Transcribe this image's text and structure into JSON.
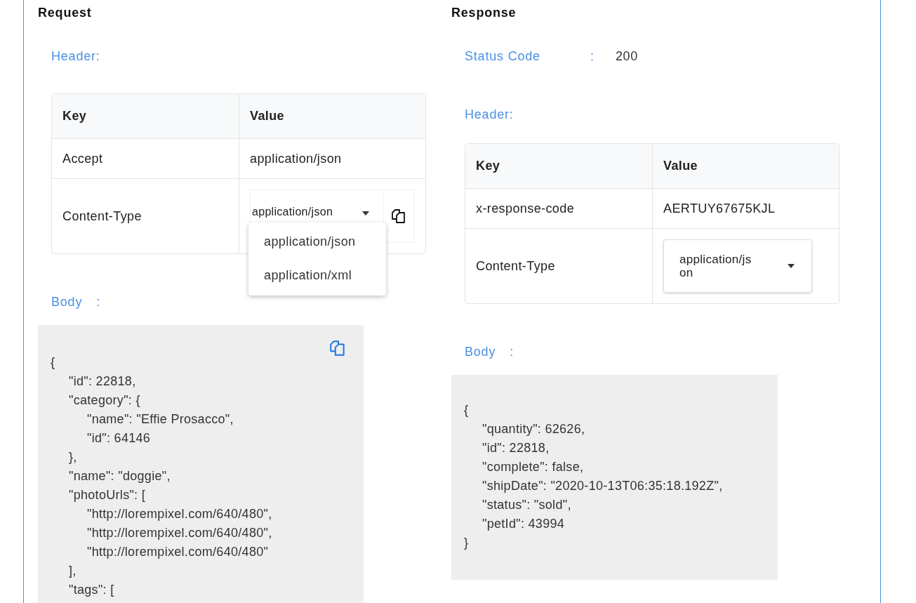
{
  "request": {
    "title": "Request",
    "header_label": "Header:",
    "table": {
      "columns": [
        "Key",
        "Value"
      ],
      "rows": [
        {
          "key": "Accept",
          "kind": "text",
          "value": "application/json"
        },
        {
          "key": "Content-Type",
          "kind": "select",
          "value": "application/json",
          "expanded": true,
          "options": [
            "application/json",
            "application/xml"
          ]
        }
      ]
    },
    "body_label": "Body",
    "body_colon": ":",
    "body": "{\n\t\"id\": 22818,\n\t\"category\": {\n\t\t\"name\": \"Effie Prosacco\",\n\t\t\"id\": 64146\n\t},\n\t\"name\": \"doggie\",\n\t\"photoUrls\": [\n\t\t\"http://lorempixel.com/640/480\",\n\t\t\"http://lorempixel.com/640/480\",\n\t\t\"http://lorempixel.com/640/480\"\n\t],\n\t\"tags\": ["
  },
  "response": {
    "title": "Response",
    "status_label": "Status Code",
    "status_colon": ":",
    "status_value": "200",
    "header_label": "Header:",
    "table": {
      "columns": [
        "Key",
        "Value"
      ],
      "rows": [
        {
          "key": "x-response-code",
          "kind": "text",
          "value": "AERTUY67675KJL"
        },
        {
          "key": "Content-Type",
          "kind": "select",
          "value": "application/json",
          "expanded": false,
          "options": []
        }
      ]
    },
    "body_label": "Body",
    "body_colon": ":",
    "body": "{\n\t\"quantity\": 62626,\n\t\"id\": 22818,\n\t\"complete\": false,\n\t\"shipDate\": \"2020-10-13T06:35:18.192Z\",\n\t\"status\": \"sold\",\n\t\"petId\": 43994\n}"
  }
}
